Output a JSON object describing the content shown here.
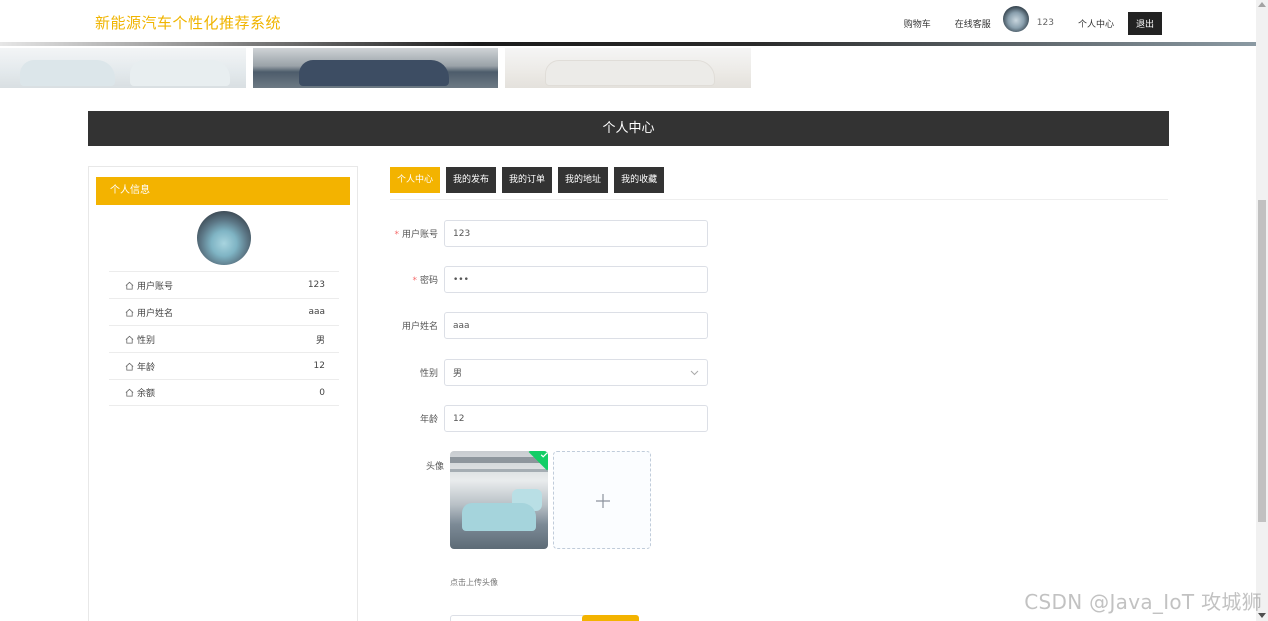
{
  "header": {
    "brand": "新能源汽车个性化推荐系统",
    "nav": {
      "cart": "购物车",
      "service": "在线客服",
      "username": "123",
      "profile": "个人中心",
      "logout": "退出"
    }
  },
  "page_title": "个人中心",
  "left_panel": {
    "title": "个人信息",
    "rows": [
      {
        "label": "用户账号",
        "value": "123"
      },
      {
        "label": "用户姓名",
        "value": "aaa"
      },
      {
        "label": "性别",
        "value": "男"
      },
      {
        "label": "年龄",
        "value": "12"
      },
      {
        "label": "余额",
        "value": "0"
      }
    ]
  },
  "tabs": [
    {
      "label": "个人中心",
      "active": true
    },
    {
      "label": "我的发布",
      "active": false
    },
    {
      "label": "我的订单",
      "active": false
    },
    {
      "label": "我的地址",
      "active": false
    },
    {
      "label": "我的收藏",
      "active": false
    }
  ],
  "form": {
    "account": {
      "label": "用户账号",
      "required": "*",
      "value": "123"
    },
    "password": {
      "label": "密码",
      "required": "*",
      "value": "•••"
    },
    "name": {
      "label": "用户姓名",
      "value": "aaa"
    },
    "gender": {
      "label": "性别",
      "value": "男"
    },
    "age": {
      "label": "年龄",
      "value": "12"
    },
    "avatar": {
      "label": "头像",
      "tip": "点击上传头像"
    }
  },
  "icons": {
    "home": "home-icon",
    "plus": "plus-icon",
    "chevron": "chevron-down-icon",
    "check": "check-icon"
  },
  "colors": {
    "accent": "#f3b300",
    "dark": "#333333",
    "brand_text": "#f0b400"
  },
  "watermark": "CSDN @Java_IoT 攻城狮"
}
